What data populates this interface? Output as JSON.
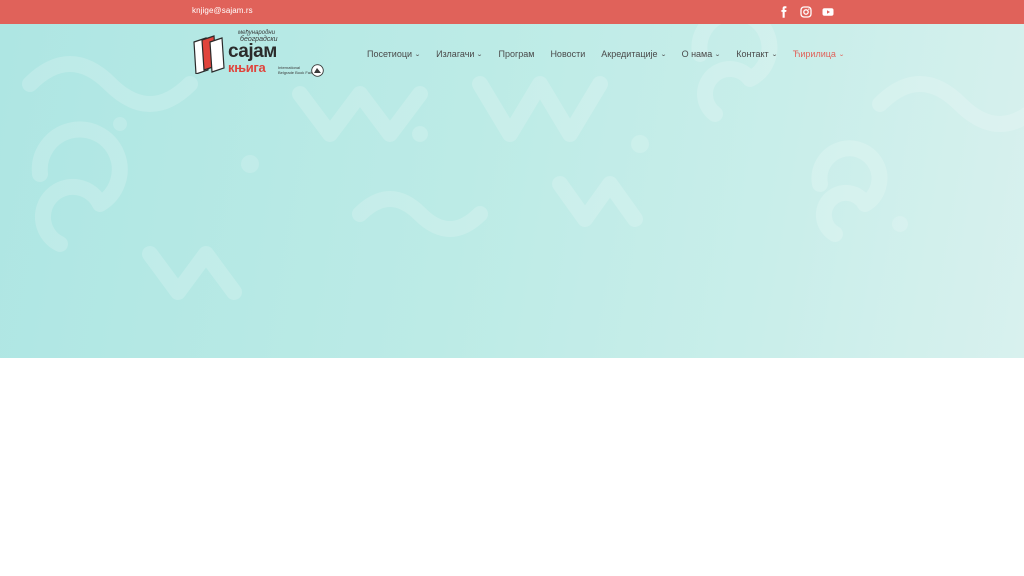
{
  "topbar": {
    "email": "knjige@sajam.rs",
    "background": "#e0625a",
    "social_icons": [
      "facebook-icon",
      "instagram-icon",
      "youtube-icon"
    ]
  },
  "logo": {
    "line1": "међународни",
    "line2": "београдски",
    "line3": "сајам",
    "line4": "књига",
    "line5": "International",
    "line6": "Belgrade Book Fair"
  },
  "nav": {
    "items": [
      {
        "label": "Посетиоци",
        "has_dropdown": true
      },
      {
        "label": "Излагачи",
        "has_dropdown": true
      },
      {
        "label": "Програм",
        "has_dropdown": false
      },
      {
        "label": "Новости",
        "has_dropdown": false
      },
      {
        "label": "Акредитације",
        "has_dropdown": true
      },
      {
        "label": "О нама",
        "has_dropdown": true
      },
      {
        "label": "Контакт",
        "has_dropdown": true
      },
      {
        "label": "Ћирилица",
        "has_dropdown": true
      }
    ],
    "active_color": "#e0625a"
  },
  "hero": {
    "gradient_start": "#aee6e3",
    "gradient_end": "#d8f1ee"
  }
}
